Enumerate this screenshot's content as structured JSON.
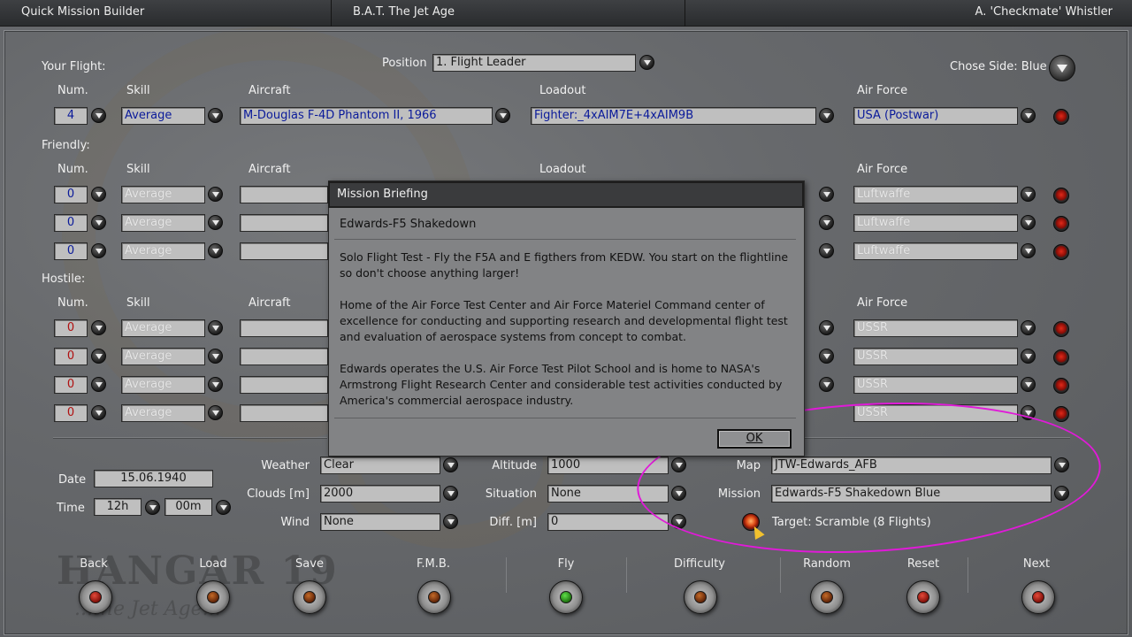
{
  "titlebar": {
    "app": "Quick Mission Builder",
    "game": "B.A.T. The Jet Age",
    "pilot": "A. 'Checkmate' Whistler"
  },
  "your_flight": {
    "section_label": "Your Flight:",
    "position_label": "Position",
    "position_value": "1. Flight Leader",
    "side_label": "Chose Side: Blue",
    "headers": {
      "num": "Num.",
      "skill": "Skill",
      "aircraft": "Aircraft",
      "loadout": "Loadout",
      "air_force": "Air Force"
    },
    "row": {
      "num": "4",
      "skill": "Average",
      "aircraft": "M-Douglas F-4D Phantom II, 1966",
      "loadout": "Fighter:_4xAIM7E+4xAIM9B",
      "air_force": "USA (Postwar)"
    }
  },
  "friendly": {
    "section_label": "Friendly:",
    "headers": {
      "num": "Num.",
      "skill": "Skill",
      "aircraft": "Aircraft",
      "loadout": "Loadout",
      "air_force": "Air Force"
    },
    "rows": [
      {
        "num": "0",
        "skill": "Average",
        "air_force": "Luftwaffe"
      },
      {
        "num": "0",
        "skill": "Average",
        "air_force": "Luftwaffe"
      },
      {
        "num": "0",
        "skill": "Average",
        "air_force": "Luftwaffe"
      }
    ]
  },
  "hostile": {
    "section_label": "Hostile:",
    "headers": {
      "num": "Num.",
      "skill": "Skill",
      "aircraft": "Aircraft",
      "air_force": "Air Force"
    },
    "rows": [
      {
        "num": "0",
        "skill": "Average",
        "air_force": "USSR"
      },
      {
        "num": "0",
        "skill": "Average",
        "air_force": "USSR"
      },
      {
        "num": "0",
        "skill": "Average",
        "air_force": "USSR"
      },
      {
        "num": "0",
        "skill": "Average",
        "air_force": "USSR"
      }
    ]
  },
  "settings": {
    "date_label": "Date",
    "date_value": "15.06.1940",
    "time_label": "Time",
    "hour_value": "12h",
    "minute_value": "00m",
    "weather_label": "Weather",
    "weather_value": "Clear",
    "clouds_label": "Clouds [m]",
    "clouds_value": "2000",
    "wind_label": "Wind",
    "wind_value": "None",
    "altitude_label": "Altitude",
    "altitude_value": "1000",
    "situation_label": "Situation",
    "situation_value": "None",
    "difficulty_label": "Diff. [m]",
    "difficulty_value": "0",
    "map_label": "Map",
    "map_value": "JTW-Edwards_AFB",
    "mission_label": "Mission",
    "mission_value": "Edwards-F5 Shakedown Blue",
    "target_text": "Target: Scramble (8 Flights)"
  },
  "dialog": {
    "title": "Mission Briefing",
    "heading": "Edwards-F5 Shakedown",
    "paragraphs": [
      "Solo Flight Test - Fly the F5A and E figthers from KEDW.  You start on the flightline so don't choose anything larger!",
      "Home of the Air Force Test Center and Air Force Materiel Command center of excellence for conducting and supporting research and developmental flight test and evaluation of aerospace systems from concept to combat.",
      "Edwards operates the U.S. Air Force Test Pilot School and is home to NASA's Armstrong Flight Research Center and considerable test activities conducted by America's commercial aerospace industry."
    ],
    "ok_label": "OK"
  },
  "bottom_buttons": [
    {
      "label": "Back",
      "lamp": "red"
    },
    {
      "label": "Load",
      "lamp": "brown"
    },
    {
      "label": "Save",
      "lamp": "brown"
    },
    {
      "label": "F.M.B.",
      "lamp": "brown"
    },
    {
      "label": "Fly",
      "lamp": "green"
    },
    {
      "label": "Difficulty",
      "lamp": "brown"
    },
    {
      "label": "Random",
      "lamp": "brown"
    },
    {
      "label": "Reset",
      "lamp": "red"
    },
    {
      "label": "Next",
      "lamp": "red"
    }
  ],
  "colors": {
    "highlight_ellipse": "#e01ad8",
    "field_bg": "#bfbfbf",
    "value_blue": "#0a1a9a",
    "value_red": "#b01010"
  }
}
